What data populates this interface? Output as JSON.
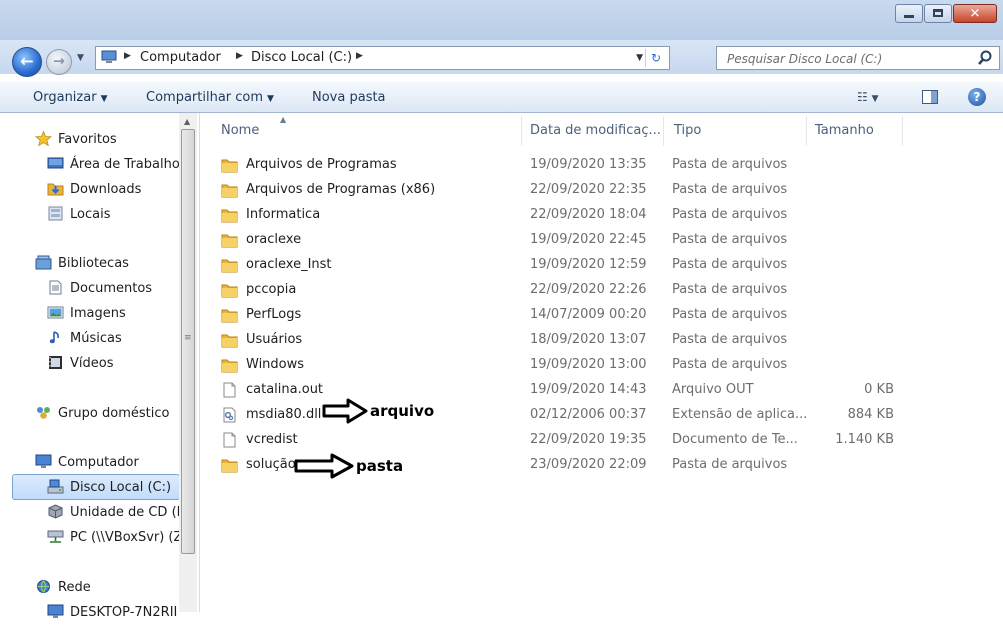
{
  "window": {
    "caption_buttons": [
      "minimize",
      "maximize",
      "close"
    ]
  },
  "address_bar": {
    "crumbs": [
      "Computador",
      "Disco Local (C:)"
    ],
    "icon": "computer-icon"
  },
  "search": {
    "placeholder": "Pesquisar Disco Local (C:)"
  },
  "toolbar": {
    "organize": "Organizar",
    "share": "Compartilhar com",
    "new_folder": "Nova pasta"
  },
  "nav_pane": {
    "items": [
      {
        "label": "Favoritos",
        "icon": "star-icon"
      },
      {
        "label": "Área de Trabalho",
        "icon": "desktop-icon"
      },
      {
        "label": "Downloads",
        "icon": "downloads-folder-icon"
      },
      {
        "label": "Locais",
        "icon": "places-icon"
      },
      {
        "label": "Bibliotecas",
        "icon": "library-icon"
      },
      {
        "label": "Documentos",
        "icon": "documents-icon"
      },
      {
        "label": "Imagens",
        "icon": "pictures-icon"
      },
      {
        "label": "Músicas",
        "icon": "music-icon"
      },
      {
        "label": "Vídeos",
        "icon": "videos-icon"
      },
      {
        "label": "Grupo doméstico",
        "icon": "homegroup-icon"
      },
      {
        "label": "Computador",
        "icon": "computer-icon"
      },
      {
        "label": "Disco Local (C:)",
        "icon": "local-disk-icon",
        "selected": true
      },
      {
        "label": "Unidade de CD (D",
        "icon": "cd-drive-icon"
      },
      {
        "label": "PC (\\\\VBoxSvr) (Z",
        "icon": "network-drive-icon"
      },
      {
        "label": "Rede",
        "icon": "network-icon"
      },
      {
        "label": "DESKTOP-7N2RII",
        "icon": "network-computer-icon"
      }
    ]
  },
  "columns": {
    "name": "Nome",
    "date": "Data de modificaç...",
    "type": "Tipo",
    "size": "Tamanho"
  },
  "files": [
    {
      "name": "Arquivos de Programas",
      "date": "19/09/2020 13:35",
      "type": "Pasta de arquivos",
      "size": "",
      "icon": "folder-icon"
    },
    {
      "name": "Arquivos de Programas (x86)",
      "date": "22/09/2020 22:35",
      "type": "Pasta de arquivos",
      "size": "",
      "icon": "folder-icon"
    },
    {
      "name": "Informatica",
      "date": "22/09/2020 18:04",
      "type": "Pasta de arquivos",
      "size": "",
      "icon": "folder-icon"
    },
    {
      "name": "oraclexe",
      "date": "19/09/2020 22:45",
      "type": "Pasta de arquivos",
      "size": "",
      "icon": "folder-icon"
    },
    {
      "name": "oraclexe_Inst",
      "date": "19/09/2020 12:59",
      "type": "Pasta de arquivos",
      "size": "",
      "icon": "folder-icon"
    },
    {
      "name": "pccopia",
      "date": "22/09/2020 22:26",
      "type": "Pasta de arquivos",
      "size": "",
      "icon": "folder-icon"
    },
    {
      "name": "PerfLogs",
      "date": "14/07/2009 00:20",
      "type": "Pasta de arquivos",
      "size": "",
      "icon": "folder-icon"
    },
    {
      "name": "Usuários",
      "date": "18/09/2020 13:07",
      "type": "Pasta de arquivos",
      "size": "",
      "icon": "folder-icon"
    },
    {
      "name": "Windows",
      "date": "19/09/2020 13:00",
      "type": "Pasta de arquivos",
      "size": "",
      "icon": "folder-icon"
    },
    {
      "name": "catalina.out",
      "date": "19/09/2020 14:43",
      "type": "Arquivo OUT",
      "size": "0 KB",
      "icon": "file-icon"
    },
    {
      "name": "msdia80.dll",
      "date": "02/12/2006 00:37",
      "type": "Extensão de aplica...",
      "size": "884 KB",
      "icon": "dll-file-icon"
    },
    {
      "name": "vcredist",
      "date": "22/09/2020 19:35",
      "type": "Documento de Te...",
      "size": "1.140 KB",
      "icon": "file-icon"
    },
    {
      "name": "solução",
      "date": "23/09/2020 22:09",
      "type": "Pasta de arquivos",
      "size": "",
      "icon": "folder-icon"
    }
  ],
  "annotations": {
    "file_label": "arquivo",
    "folder_label": "pasta"
  }
}
